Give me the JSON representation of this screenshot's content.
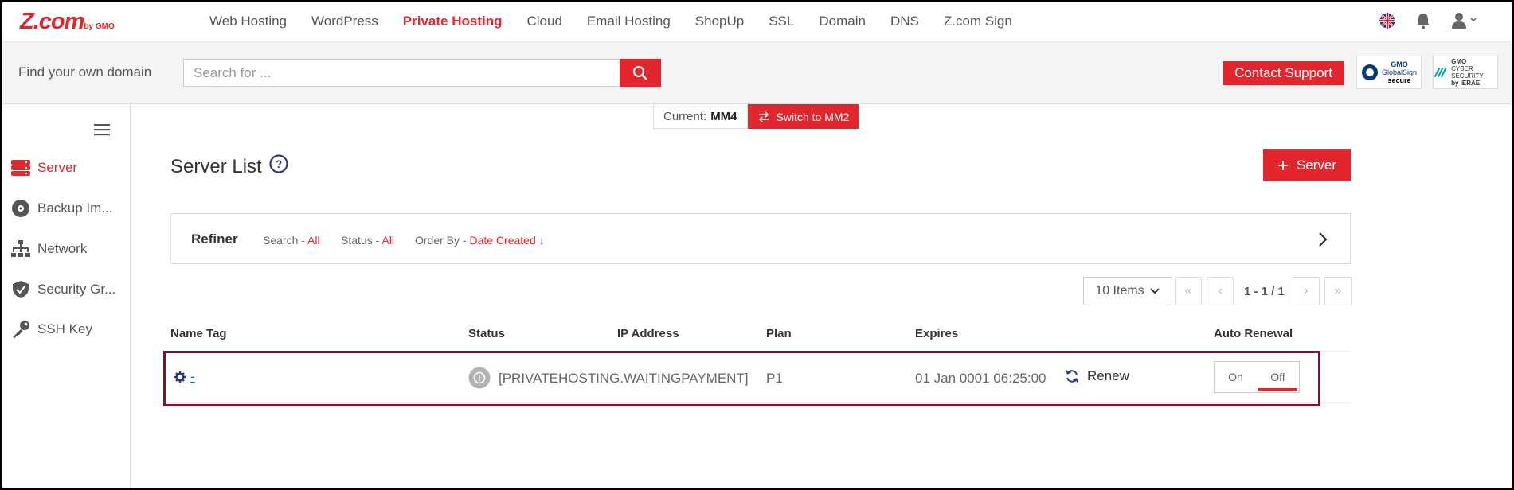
{
  "brand": {
    "name": "Z.com",
    "by": "by GMO"
  },
  "nav": {
    "items": [
      "Web Hosting",
      "WordPress",
      "Private Hosting",
      "Cloud",
      "Email Hosting",
      "ShopUp",
      "SSL",
      "Domain",
      "DNS",
      "Z.com Sign"
    ],
    "active": "Private Hosting"
  },
  "search": {
    "label": "Find your own domain",
    "placeholder": "Search for ..."
  },
  "contact_support": "Contact Support",
  "badges": {
    "globalsign_line1": "GMO",
    "globalsign_line2": "GlobalSign",
    "globalsign_line3": "secure",
    "ierae_line1": "GMO",
    "ierae_line2": "CYBER SECURITY",
    "ierae_line3": "by IERAE"
  },
  "sidebar": {
    "items": [
      {
        "label": "Server",
        "icon": "server-icon",
        "active": true
      },
      {
        "label": "Backup Im...",
        "icon": "disc-icon",
        "active": false
      },
      {
        "label": "Network",
        "icon": "network-icon",
        "active": false
      },
      {
        "label": "Security Gr...",
        "icon": "shield-icon",
        "active": false
      },
      {
        "label": "SSH Key",
        "icon": "key-icon",
        "active": false
      }
    ]
  },
  "version": {
    "current_label": "Current:",
    "current_value": "MM4",
    "switch_label": "Switch to MM2"
  },
  "page": {
    "title": "Server List",
    "add_button": "Server"
  },
  "refiner": {
    "title": "Refiner",
    "search_label": "Search -",
    "search_value": "All",
    "status_label": "Status -",
    "status_value": "All",
    "order_label": "Order By -",
    "order_value": "Date Created ↓"
  },
  "pagination": {
    "per_page": "10 Items",
    "info": "1 - 1 / 1"
  },
  "table": {
    "headers": [
      "Name Tag",
      "Status",
      "IP Address",
      "Plan",
      "Expires",
      "Auto Renewal"
    ],
    "rows": [
      {
        "name_tag": "-",
        "status": "[PRIVATEHOSTING.WAITINGPAYMENT]",
        "ip_address": "",
        "plan": "P1",
        "expires": "01 Jan 0001 06:25:00",
        "renew_label": "Renew",
        "auto_renewal": {
          "on": "On",
          "off": "Off",
          "selected": "Off"
        }
      }
    ]
  },
  "colors": {
    "accent": "#e3262d",
    "highlight_border": "#8b0e2a",
    "link": "#1a5fb4"
  }
}
